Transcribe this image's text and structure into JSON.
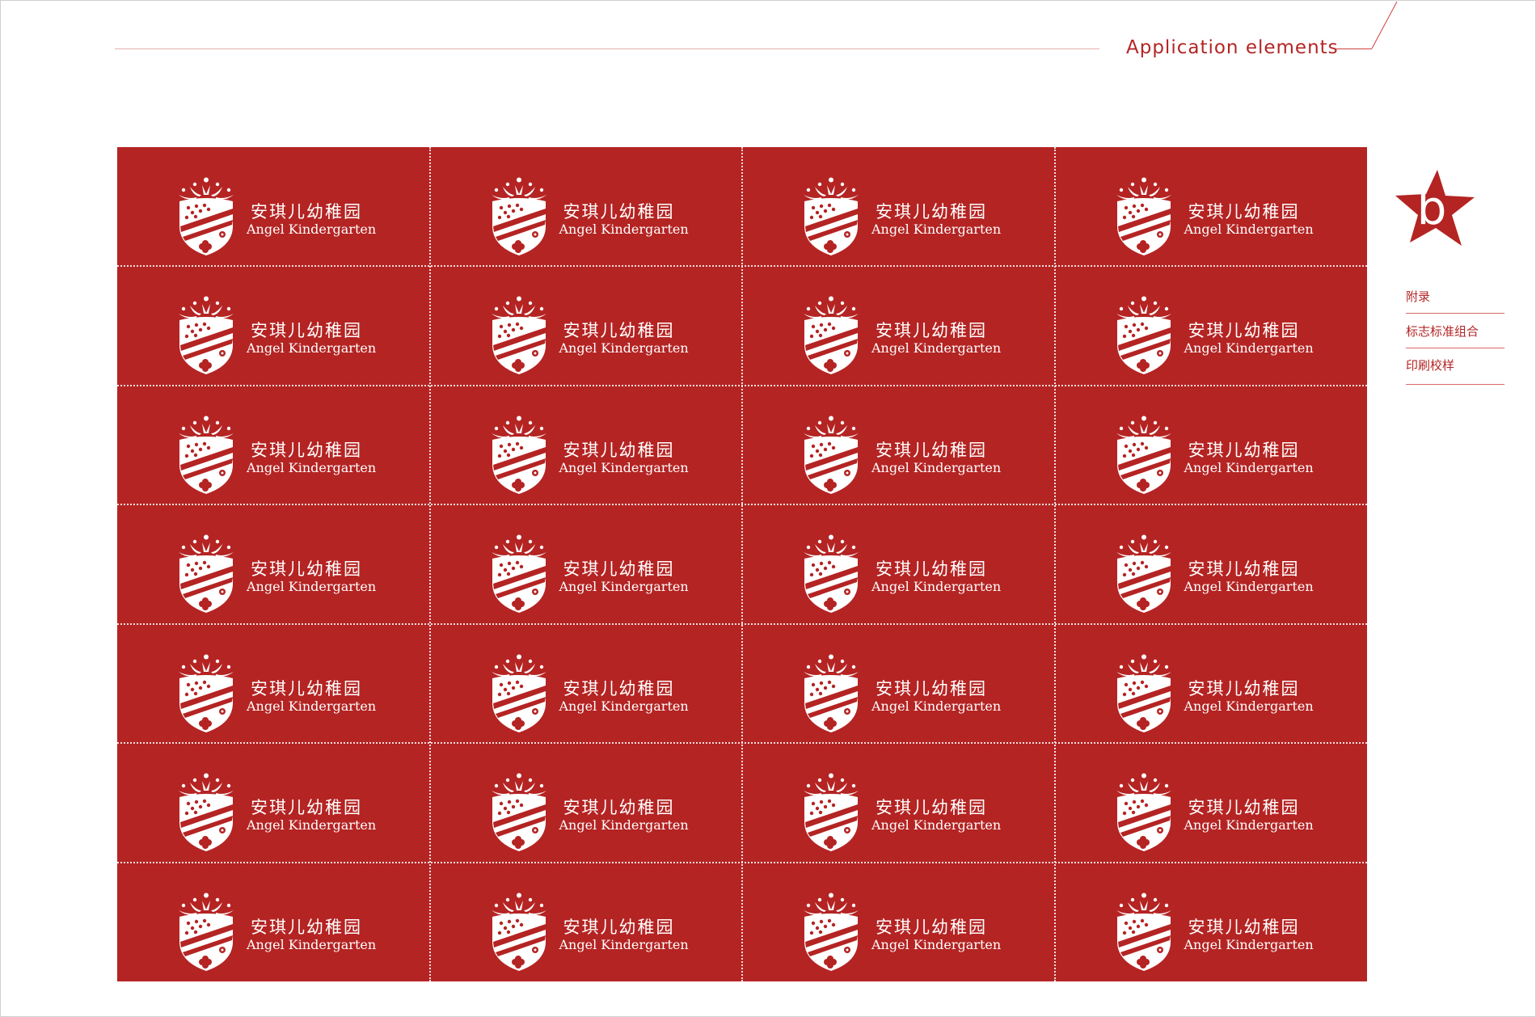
{
  "header": {
    "title": "Application elements"
  },
  "colors": {
    "accent": "#b42423",
    "rule": "#e3b0ac",
    "white": "#ffffff"
  },
  "label": {
    "name_cn": "安琪儿幼稚园",
    "name_en": "Angel Kindergarten",
    "logo_icon": "crest-crown-icon"
  },
  "sheet": {
    "columns": 4,
    "rows": 7
  },
  "side_nav": {
    "badge_letter": "b",
    "badge_icon": "star-icon",
    "items": [
      {
        "label": "附录"
      },
      {
        "label": "标志标准组合"
      },
      {
        "label": "印刷校样"
      }
    ]
  }
}
